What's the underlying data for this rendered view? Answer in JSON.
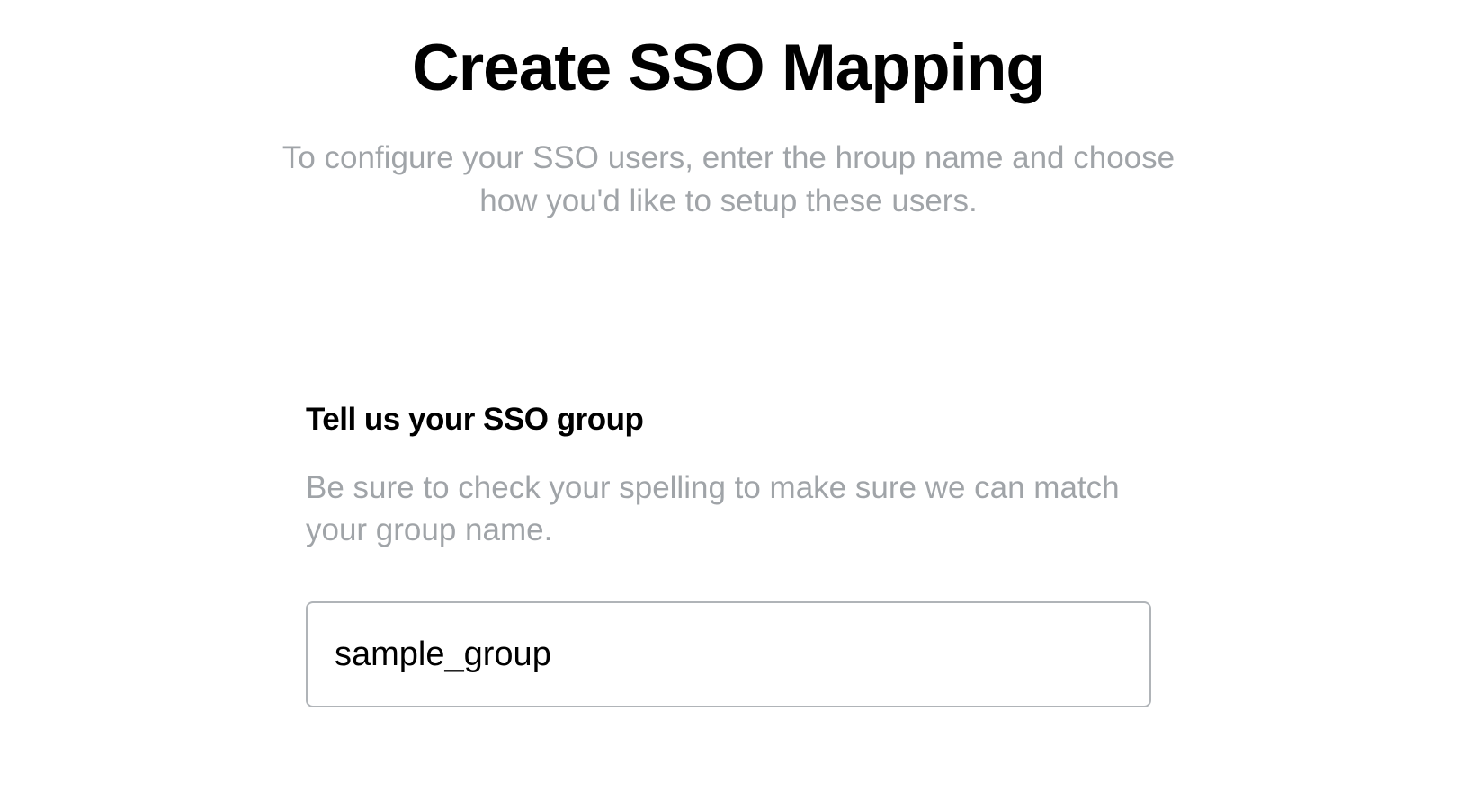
{
  "header": {
    "title": "Create SSO Mapping",
    "subtitle": "To configure your SSO users, enter the hroup name and choose how you'd like to setup these users."
  },
  "form": {
    "group_section": {
      "heading": "Tell us your SSO group",
      "helper": "Be sure to check your spelling to make sure we can match your group name.",
      "input_value": "sample_group",
      "input_placeholder": ""
    }
  }
}
